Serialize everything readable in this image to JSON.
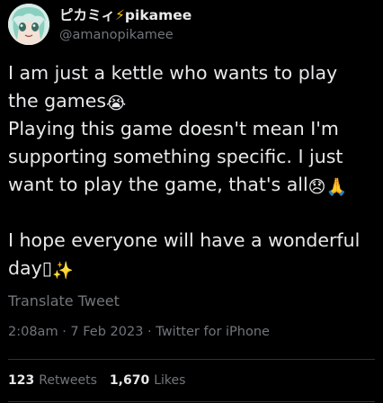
{
  "author": {
    "display_name": "ピカミィ",
    "display_name_emoji": "⚡",
    "display_name_suffix": "pikamee",
    "handle": "@amanopikamee"
  },
  "tweet": {
    "line1": "I am just a kettle who wants to play",
    "line2": "the games",
    "emoji_cry": "😭",
    "line3": "Playing this game doesn't mean I'm",
    "line4": "supporting something specific. I just",
    "line5": "want to play the game, that's all",
    "emoji_sad": "😞",
    "emoji_pray": "🙏",
    "line6": "I hope everyone will have a wonderful",
    "line7": "day",
    "glyph_box": "▯",
    "emoji_sparkles": "✨"
  },
  "translate_label": "Translate Tweet",
  "meta": {
    "time": "2:08am",
    "separator": "·",
    "date": "7 Feb 2023",
    "source": "Twitter for iPhone"
  },
  "stats": {
    "retweets_count": "123",
    "retweets_label": "Retweets",
    "likes_count": "1,670",
    "likes_label": "Likes"
  },
  "colors": {
    "background": "#000000",
    "text": "#e7e9ea",
    "secondary": "#71767b",
    "divider": "#2f3336",
    "bolt": "#f5c400"
  }
}
